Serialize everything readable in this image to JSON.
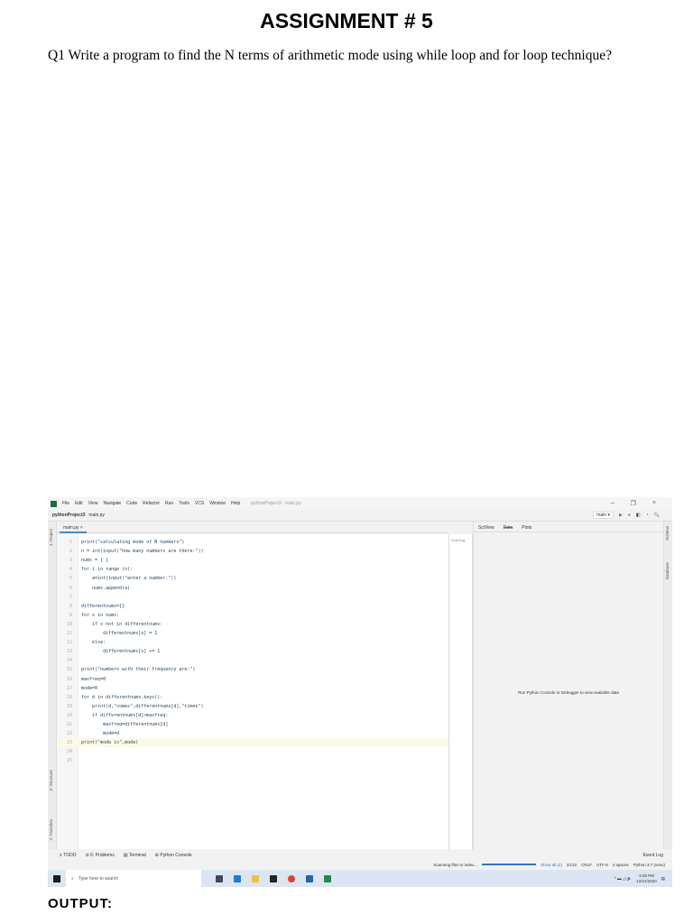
{
  "document": {
    "title": "ASSIGNMENT # 5",
    "question": "Q1 Write a program to find the N terms of arithmetic mode using while loop and for loop technique?",
    "output_label": "OUTPUT:"
  },
  "ide": {
    "menu": [
      "File",
      "Edit",
      "View",
      "Navigate",
      "Code",
      "Refactor",
      "Run",
      "Tools",
      "VCS",
      "Window",
      "Help"
    ],
    "window_title": "pythonProject3 - main.py",
    "window_controls": [
      "–",
      "❐",
      "×"
    ],
    "breadcrumb": {
      "project": "pythonProject3",
      "file": "main.py"
    },
    "run_config": "main ▾",
    "editor_tab": "main.py ×",
    "left_stripe": [
      "1: Project",
      "Z: Structure",
      "2: Favorites"
    ],
    "right_stripe": [
      "SciView",
      "Database"
    ],
    "indexing": "Indexing...",
    "code_lines": [
      "print(\"calculating mode of N numbers\")",
      "n = int(input(\"how many numbers are there:\"))",
      "nums = [ ]",
      "for i in range (n):",
      "    a=int(input(\"enter a number:\"))",
      "    nums.append(a)",
      "",
      "differentnums={}",
      "for x in nums:",
      "    if x not in differentnums:",
      "        differentnums[x] = 1",
      "    else:",
      "        differentnums[x] += 1",
      "",
      "print(\"numbers with their frequency are:\")",
      "maxfreq=0",
      "mode=0",
      "for d in differentnums.keys():",
      "    print(d,\"comes\",differentnums[d],\"times\")",
      "    if differentnums[d]>maxfreq:",
      "        maxfreq=differentnums[d]",
      "        mode=d",
      "print(\"mode is\",mode)",
      "",
      ""
    ],
    "current_line": 23,
    "sciview_tabs": [
      "SciView",
      "Data",
      "Plots"
    ],
    "sciview_message": "Run Python Console or Debugger to view available data",
    "tool_tabs": [
      "≡ TODO",
      "⊘ 6: Problems",
      "▤ Terminal",
      "⊕ Python Console"
    ],
    "event_log": "Event Log",
    "status": {
      "scanning": "Scanning files to index...",
      "show_all": "Show all (2)",
      "position": "23:22",
      "line_sep": "CRLF",
      "encoding": "UTF-8",
      "indent": "4 spaces",
      "interpreter": "Python 3.7 (venv)"
    },
    "taskbar": {
      "search_placeholder": "Type here to search",
      "time": "3:28 PM",
      "date": "12/21/2020",
      "tray": "^ ▬ ◿ 🔈"
    }
  }
}
